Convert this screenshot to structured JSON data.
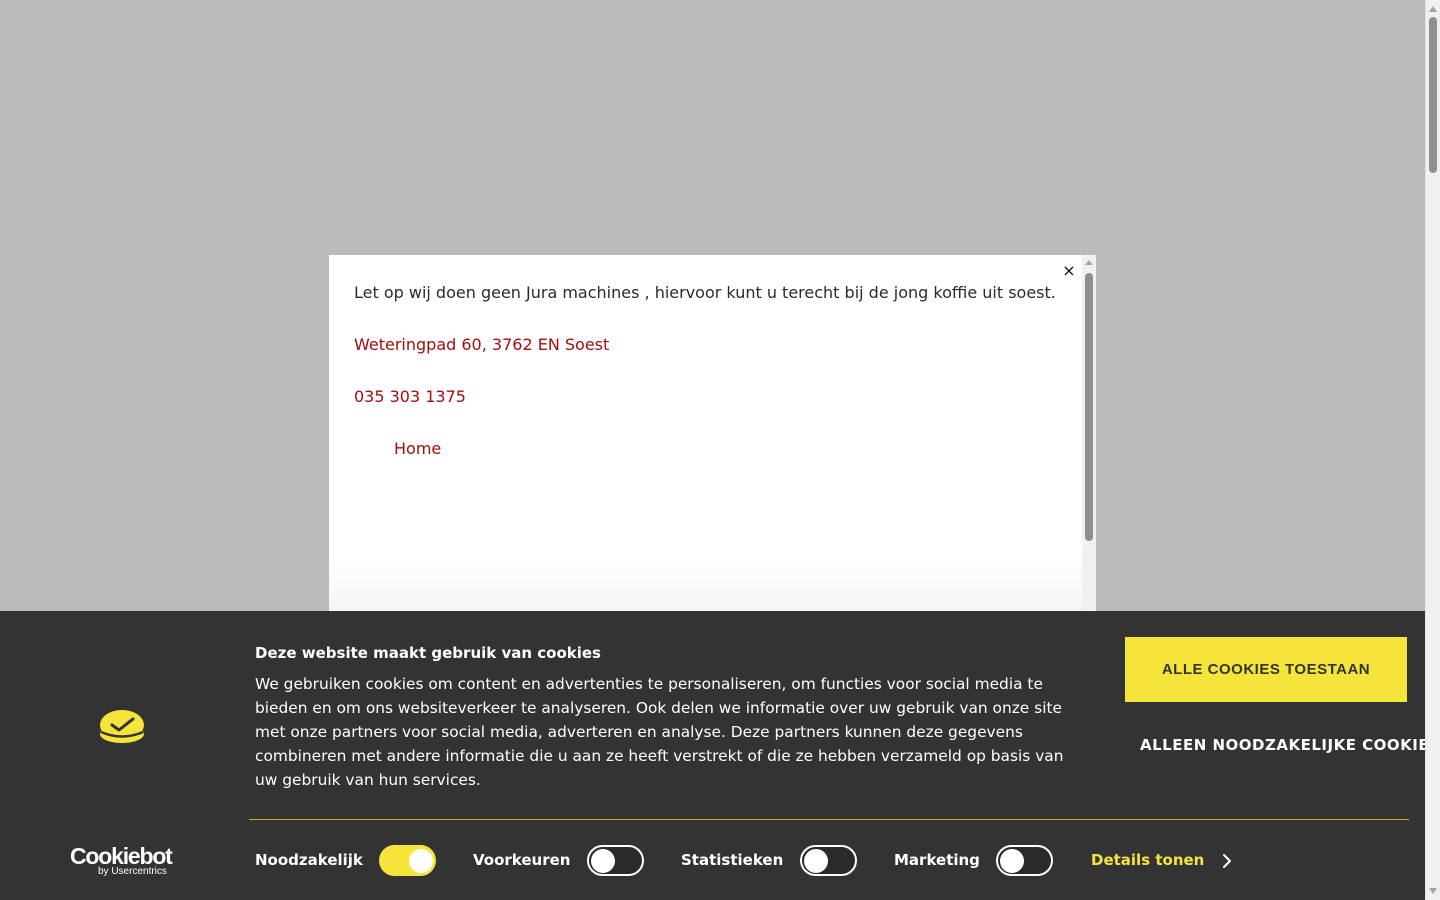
{
  "modal": {
    "close_label": "×",
    "notice": "Let op wij doen geen Jura machines , hiervoor kunt u terecht bij de jong koffie uit soest.",
    "address": "Weteringpad 60, 3762 EN Soest",
    "phone": "035 303 1375",
    "home_link": "Home"
  },
  "cookie_banner": {
    "title": "Deze website maakt gebruik van cookies",
    "body": "We gebruiken cookies om content en advertenties te personaliseren, om functies voor social media te bieden en om ons websiteverkeer te analyseren. Ook delen we informatie over uw gebruik van onze site met onze partners voor social media, adverteren en analyse. Deze partners kunnen deze gegevens combineren met andere informatie die u aan ze heeft verstrekt of die ze hebben verzameld op basis van uw gebruik van hun services.",
    "allow_all_label": "ALLE COOKIES TOESTAAN",
    "necessary_only_label": "ALLEEN NOODZAKELIJKE COOKIES",
    "brand": "Cookiebot",
    "brand_sub": "by Usercentrics",
    "toggles": [
      {
        "label": "Noodzakelijk",
        "checked": true
      },
      {
        "label": "Voorkeuren",
        "checked": false
      },
      {
        "label": "Statistieken",
        "checked": false
      },
      {
        "label": "Marketing",
        "checked": false
      }
    ],
    "details_label": "Details tonen",
    "colors": {
      "background": "#333333",
      "accent": "#f5e53a",
      "link": "#a50d0d"
    }
  }
}
